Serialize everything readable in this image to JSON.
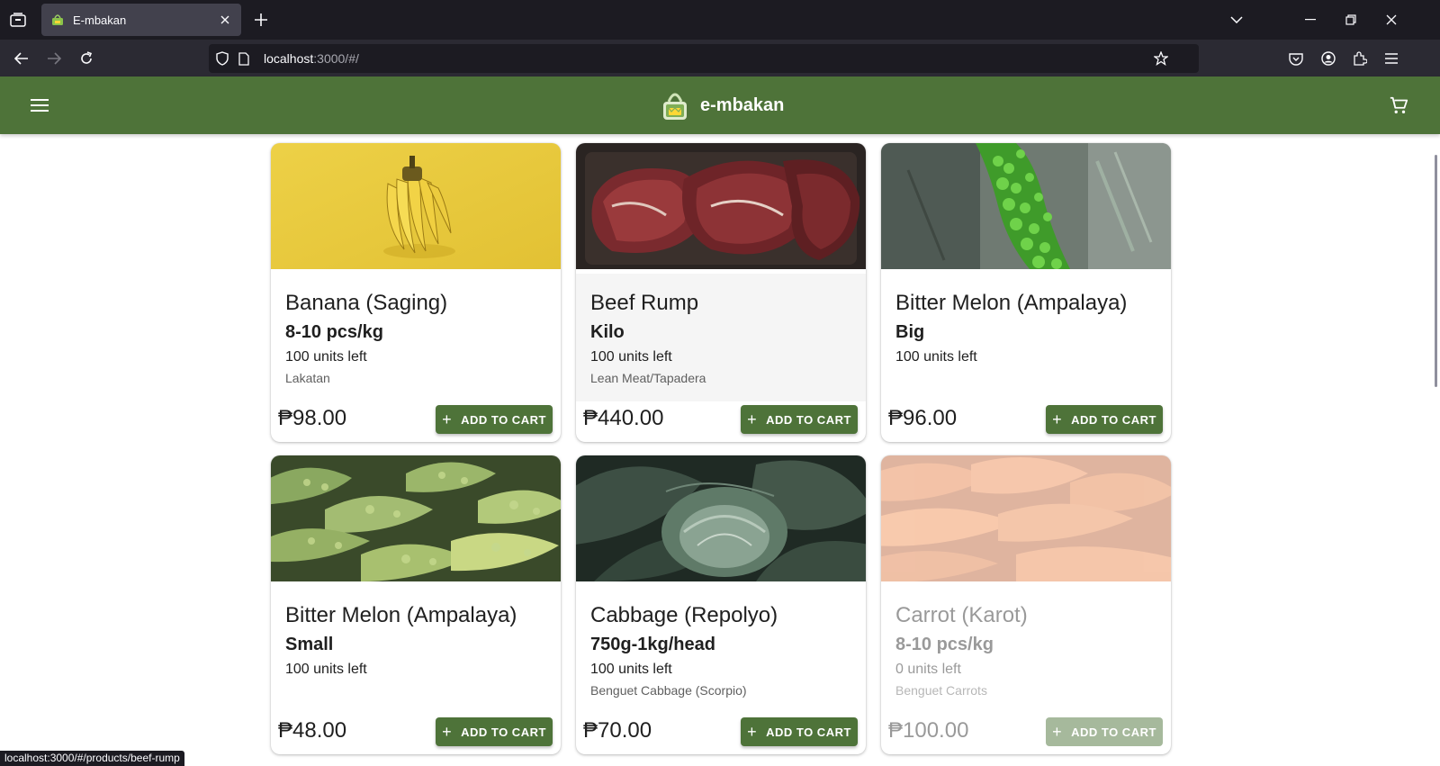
{
  "browser": {
    "tab_title": "E-mbakan",
    "url_host": "localhost",
    "url_rest": ":3000/#/",
    "status_link": "localhost:3000/#/products/beef-rump"
  },
  "colors": {
    "brand_green": "#4e7339",
    "browser_dark": "#1c1b22",
    "browser_toolbar": "#2b2a33"
  },
  "app": {
    "brand": "e-mbakan",
    "menu_icon": "hamburger-icon",
    "cart_icon": "cart-icon"
  },
  "products": [
    {
      "name": "Banana (Saging)",
      "variant": "8-10 pcs/kg",
      "stock": "100 units left",
      "description": "Lakatan",
      "price": "₱98.00",
      "button": "ADD TO CART",
      "image": "bananas-on-yellow"
    },
    {
      "name": "Beef Rump",
      "variant": "Kilo",
      "stock": "100 units left",
      "description": "Lean Meat/Tapadera",
      "price": "₱440.00",
      "button": "ADD TO CART",
      "image": "raw-beef-steaks"
    },
    {
      "name": "Bitter Melon (Ampalaya)",
      "variant": "Big",
      "stock": "100 units left",
      "description": "",
      "price": "₱96.00",
      "button": "ADD TO CART",
      "image": "bitter-melon-on-vine"
    },
    {
      "name": "Bitter Melon (Ampalaya)",
      "variant": "Small",
      "stock": "100 units left",
      "description": "",
      "price": "₱48.00",
      "button": "ADD TO CART",
      "image": "pile-of-bitter-melons"
    },
    {
      "name": "Cabbage (Repolyo)",
      "variant": "750g-1kg/head",
      "stock": "100 units left",
      "description": "Benguet Cabbage (Scorpio)",
      "price": "₱70.00",
      "button": "ADD TO CART",
      "image": "cabbage-head"
    },
    {
      "name": "Carrot (Karot)",
      "variant": "8-10 pcs/kg",
      "stock": "0 units left",
      "description": "Benguet Carrots",
      "price": "₱100.00",
      "button": "ADD TO CART",
      "image": "carrots-pile"
    }
  ]
}
